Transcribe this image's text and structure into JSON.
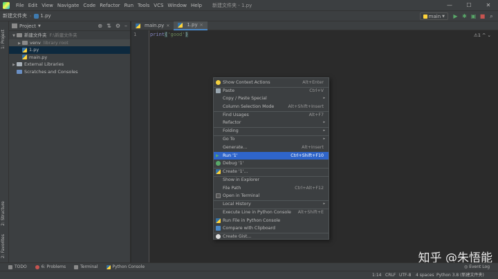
{
  "window": {
    "title": "新建文件夹 - 1.py",
    "menu": [
      "File",
      "Edit",
      "View",
      "Navigate",
      "Code",
      "Refactor",
      "Run",
      "Tools",
      "VCS",
      "Window",
      "Help"
    ],
    "controls": [
      "—",
      "☐",
      "✕"
    ]
  },
  "navbar": {
    "crumbs": [
      "新建文件夹",
      "1.py"
    ],
    "run_config": "main"
  },
  "toolstrip": {
    "left_tabs": [
      "1: Project",
      "2: Structure",
      "2: Favorites"
    ]
  },
  "project": {
    "header": "Project",
    "tree": [
      {
        "label": "新建文件夹",
        "hint": "F:\\新建文件夹",
        "kind": "folder"
      },
      {
        "label": "venv",
        "hint": "library root",
        "kind": "folder-lib"
      },
      {
        "label": "1.py",
        "kind": "py"
      },
      {
        "label": "main.py",
        "kind": "py"
      },
      {
        "label": "External Libraries",
        "kind": "lib"
      },
      {
        "label": "Scratches and Consoles",
        "kind": "scratch"
      }
    ]
  },
  "editor": {
    "tabs": [
      "main.py",
      "1.py"
    ],
    "line_number": "1",
    "code": {
      "fn": "print",
      "open": "(",
      "str": "'good'",
      "close": ")"
    },
    "inspection": "⚠1 ^ ⌄"
  },
  "context_menu": {
    "items": [
      {
        "label": "Show Context Actions",
        "shortcut": "Alt+Enter"
      },
      {
        "label": "Paste",
        "shortcut": "Ctrl+V"
      },
      {
        "label": "Copy / Paste Special",
        "shortcut": "▸"
      },
      {
        "label": "Column Selection Mode",
        "shortcut": "Alt+Shift+Insert"
      },
      {
        "label": "Find Usages",
        "shortcut": "Alt+F7"
      },
      {
        "label": "Refactor",
        "shortcut": "▸"
      },
      {
        "label": "Folding",
        "shortcut": "▸"
      },
      {
        "label": "Go To",
        "shortcut": "▸"
      },
      {
        "label": "Generate...",
        "shortcut": "Alt+Insert"
      },
      {
        "label": "Run '1'",
        "shortcut": "Ctrl+Shift+F10"
      },
      {
        "label": "Debug '1'",
        "shortcut": ""
      },
      {
        "label": "Create '1'...",
        "shortcut": ""
      },
      {
        "label": "Show in Explorer",
        "shortcut": ""
      },
      {
        "label": "File Path",
        "shortcut": "Ctrl+Alt+F12"
      },
      {
        "label": "Open in Terminal",
        "shortcut": ""
      },
      {
        "label": "Local History",
        "shortcut": "▸"
      },
      {
        "label": "Execute Line in Python Console",
        "shortcut": "Alt+Shift+E"
      },
      {
        "label": "Run File in Python Console",
        "shortcut": ""
      },
      {
        "label": "Compare with Clipboard",
        "shortcut": ""
      },
      {
        "label": "Create Gist...",
        "shortcut": ""
      }
    ]
  },
  "bottom_tabs": [
    "TODO",
    "6: Problems",
    "Terminal",
    "Python Console"
  ],
  "event_log": "Event Log",
  "status": {
    "position": "1:14",
    "line_sep": "CRLF",
    "encoding": "UTF-8",
    "indent": "4 spaces",
    "interpreter": "Python 3.8 (新建文件夹)"
  },
  "watermark": "知乎 @朱悟能"
}
